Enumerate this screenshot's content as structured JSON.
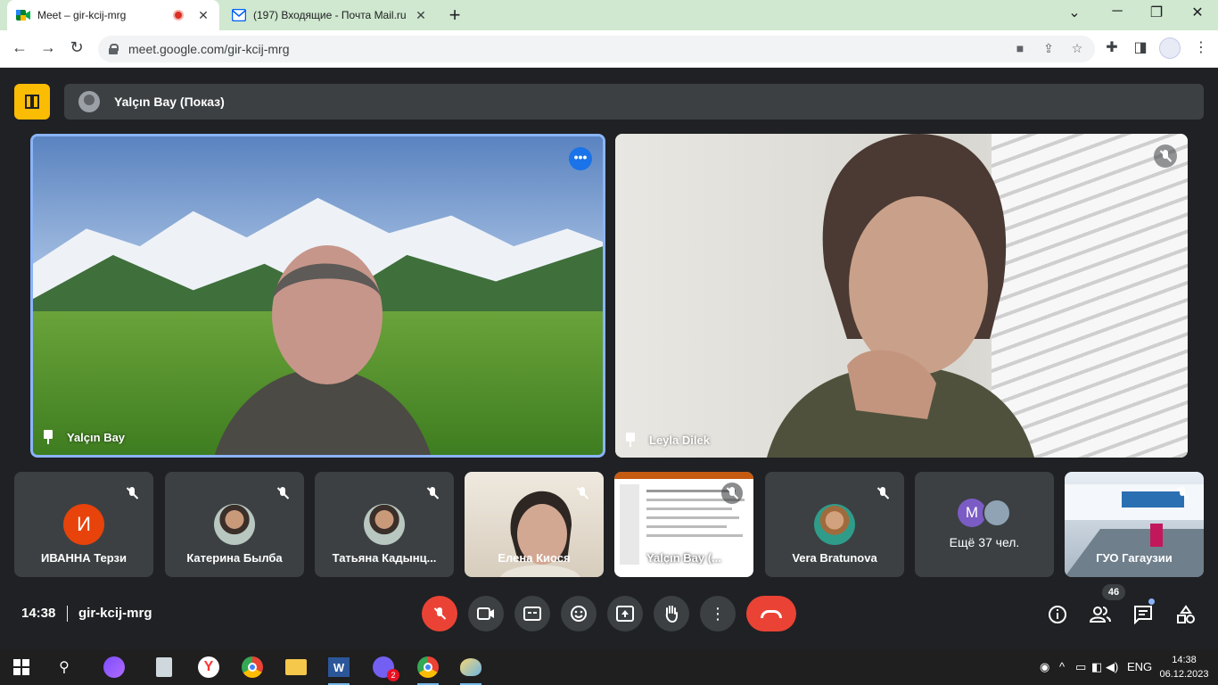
{
  "browser": {
    "tabs": [
      {
        "title": "Meet – gir-kcij-mrg",
        "icon": "google-meet-icon",
        "recording": true,
        "active": true
      },
      {
        "title": "(197) Входящие - Почта Mail.ru",
        "icon": "mail-icon",
        "active": false
      }
    ],
    "new_tab_label": "+",
    "url": "meet.google.com/gir-kcij-mrg",
    "window_controls": {
      "minimize": "─",
      "restore": "❐",
      "close": "✕"
    }
  },
  "meet": {
    "presenting_banner": "Yalçın Bay (Показ)",
    "main_tiles": [
      {
        "name": "Yalçın Bay",
        "pinned": true,
        "speaking": true
      },
      {
        "name": "Leyla Dilek",
        "pinned": true,
        "muted": true
      }
    ],
    "strip": [
      {
        "name": "ИВАННА Терзи",
        "avatar_letter": "И",
        "muted": true
      },
      {
        "name": "Катерина Былба",
        "muted": true
      },
      {
        "name": "Татьяна Кадынц...",
        "muted": true
      },
      {
        "name": "Елена Киося",
        "muted": true
      },
      {
        "name": "Yalçın Bay (...",
        "muted": true
      },
      {
        "name": "Vera Bratunova",
        "muted": true
      },
      {
        "name": "Ещё 37 чел.",
        "avatar_letter": "M"
      },
      {
        "name": "ГУО Гагаузии",
        "muted": true
      }
    ],
    "time": "14:38",
    "meeting_code": "gir-kcij-mrg",
    "participants_count": "46",
    "colors": {
      "accent": "#8ab4f8",
      "leave": "#ea4335",
      "present": "#fbbc04",
      "background": "#202124"
    }
  },
  "taskbar": {
    "language": "ENG",
    "time": "14:38",
    "date": "06.12.2023",
    "viber_badge": "2"
  }
}
